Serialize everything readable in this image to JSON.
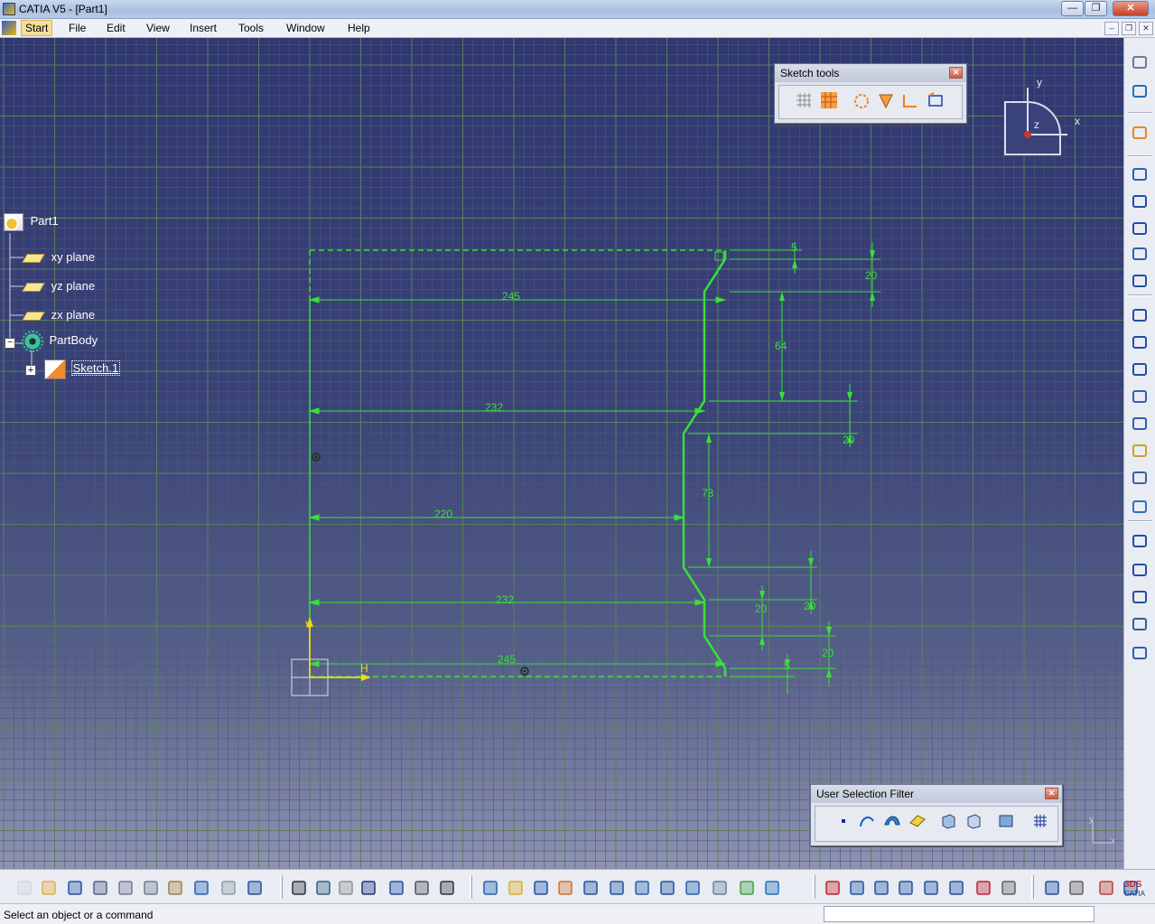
{
  "window": {
    "title": "CATIA V5 - [Part1]",
    "minimize": "—",
    "restore": "❐",
    "close": "✕"
  },
  "menu": {
    "items": [
      "Start",
      "File",
      "Edit",
      "View",
      "Insert",
      "Tools",
      "Window",
      "Help"
    ],
    "active": "Start",
    "mdi_min": "–",
    "mdi_restore": "❐",
    "mdi_close": "✕"
  },
  "tree": {
    "root": "Part1",
    "planes": [
      "xy plane",
      "yz plane",
      "zx plane"
    ],
    "body": "PartBody",
    "sketch": "Sketch.1"
  },
  "sketch_tools": {
    "title": "Sketch tools",
    "close": "✕",
    "icons": [
      "grid-icon",
      "snap-to-point-icon",
      "construction-element-icon",
      "geometrical-constraints-icon",
      "dimensional-constraints-icon",
      "automatic-constraint-icon"
    ]
  },
  "selection_filter": {
    "title": "User Selection Filter",
    "close": "✕",
    "icons": [
      "point-filter-icon",
      "curve-filter-icon",
      "surface-filter-icon",
      "volume-filter-icon",
      "feature-filter-icon",
      "geometrical-element-filter-icon",
      "tool-filter-icon",
      "work-on-support-filter-icon"
    ]
  },
  "compass": {
    "x_label": "x",
    "y_label": "y",
    "z_label": "z"
  },
  "sketch": {
    "h_label": "H",
    "v_label": "V",
    "dimensions": {
      "d245_top": "245",
      "d232_upper": "232",
      "d220": "220",
      "d232_lower": "232",
      "d245_bottom": "245",
      "d5_top": "5",
      "d20_top": "20",
      "d64": "64",
      "d20_upper_right": "20",
      "d78": "78",
      "d20_lower_right": "20",
      "d20_lower_mid": "20",
      "d20_bottom_right": "20",
      "d5_bottom": "5"
    }
  },
  "mini_axis": {
    "x_label": "x",
    "y_label": "y"
  },
  "status": {
    "message": "Select an object or a command"
  },
  "right_toolbar": {
    "icons": [
      "sketch-icon",
      "exit-workbench-icon",
      "select-icon",
      "profile-icon",
      "rectangle-icon",
      "circle-icon",
      "spline-icon",
      "ellipse-icon",
      "line-icon",
      "axis-icon",
      "point-icon",
      "corner-icon",
      "chamfer-icon",
      "trim-icon",
      "mirror-icon",
      "project-3d-elements-icon",
      "constraint-icon",
      "constraint-dialog-icon",
      "fix-together-icon",
      "sketch-analysis-icon",
      "cut-part-by-plane-icon"
    ]
  },
  "bottom_toolbar": {
    "icons": [
      "new-icon",
      "open-icon",
      "save-icon",
      "print-icon",
      "cut-icon",
      "copy-icon",
      "paste-icon",
      "undo-icon",
      "redo-icon",
      "whats-this-icon",
      "formula-icon",
      "knowledge-advisor-icon",
      "macro-icon",
      "catalog-icon",
      "tree-expand-icon",
      "lock-icon",
      "measure-icon",
      "fly-mode-icon",
      "fit-all-icon",
      "pan-icon",
      "rotate-icon",
      "zoom-in-icon",
      "zoom-out-icon",
      "normal-view-icon",
      "multi-view-icon",
      "iso-view-icon",
      "shading-icon",
      "hide-show-icon",
      "swap-visible-space-icon",
      "sketcher-icon",
      "pad-icon",
      "pocket-icon",
      "shaft-icon",
      "groove-icon",
      "hole-icon",
      "rib-icon",
      "slot-icon",
      "stiffener-icon",
      "multi-section-icon",
      "measure-between-icon",
      "apply-material-icon",
      "catia-logo"
    ]
  },
  "colors": {
    "sketch_green": "#38e038",
    "canvas_top": "#303771",
    "canvas_bottom": "#8d93b0",
    "grid_line": "#5c7f5c"
  }
}
